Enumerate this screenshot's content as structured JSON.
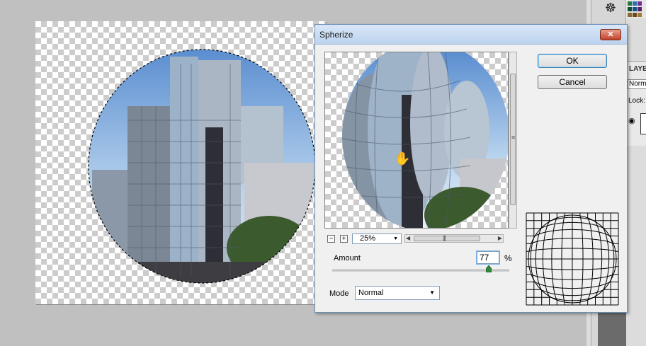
{
  "dialog": {
    "title": "Spherize",
    "close_label": "✕",
    "ok_label": "OK",
    "cancel_label": "Cancel",
    "zoom_out_label": "−",
    "zoom_in_label": "+",
    "zoom_value": "25%",
    "amount_label": "Amount",
    "amount_value": "77",
    "amount_unit": "%",
    "amount_fraction": 0.885,
    "mode_label": "Mode",
    "mode_value": "Normal"
  },
  "layers_panel": {
    "tab_label": "LAYE",
    "blend_mode": "Norm",
    "lock_label": "Lock:"
  },
  "icons": {
    "navigator": "ship-wheel-icon",
    "visibility": "eye-icon",
    "hand_cursor": "hand-cursor-icon",
    "dropdown": "chevron-down-icon"
  },
  "colors": {
    "title_gradient_top": "#d9e7f7",
    "close_button": "#c1412a",
    "focus_border": "#3c7fb1",
    "sky": "#8fb8e0"
  }
}
